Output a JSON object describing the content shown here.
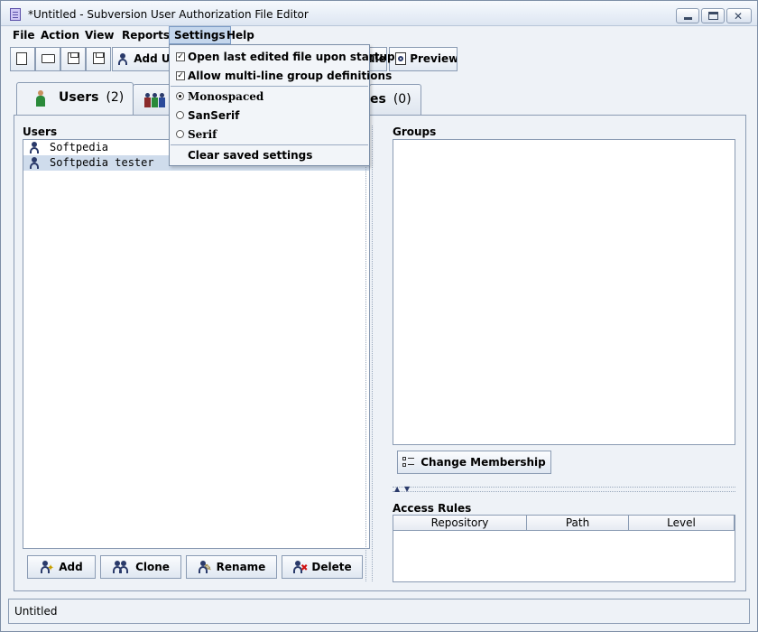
{
  "window": {
    "title": "*Untitled - Subversion User Authorization File Editor"
  },
  "menubar": {
    "items": [
      "File",
      "Action",
      "View",
      "Reports",
      "Settings",
      "Help"
    ],
    "active": "Settings"
  },
  "toolbar": {
    "add_user_label": "Add Us",
    "rule_label": "ule",
    "preview_label": "Preview"
  },
  "tabs": [
    {
      "label": "Users",
      "count": "(2)",
      "selected": true
    },
    {
      "label": "Groups",
      "count": ""
    },
    {
      "label": "es",
      "count": "(0)"
    }
  ],
  "users_panel": {
    "label": "Users",
    "items": [
      {
        "name": "Softpedia",
        "selected": false
      },
      {
        "name": "Softpedia tester",
        "selected": true
      }
    ],
    "buttons": {
      "add": "Add",
      "clone": "Clone",
      "rename": "Rename",
      "delete": "Delete"
    }
  },
  "groups_panel": {
    "label": "Groups",
    "change_membership": "Change Membership"
  },
  "access_rules": {
    "label": "Access Rules",
    "columns": [
      "Repository",
      "Path",
      "Level"
    ]
  },
  "settings_menu": {
    "open_last": "Open last edited file upon startup",
    "open_last_checked": true,
    "multiline_groups": "Allow multi-line group definitions",
    "multiline_groups_checked": true,
    "font_monospaced": "Monospaced",
    "font_sanserif": "SanSerif",
    "font_serif": "Serif",
    "selected_font": "Monospaced",
    "clear_settings": "Clear saved settings"
  },
  "statusbar": {
    "text": "Untitled"
  }
}
